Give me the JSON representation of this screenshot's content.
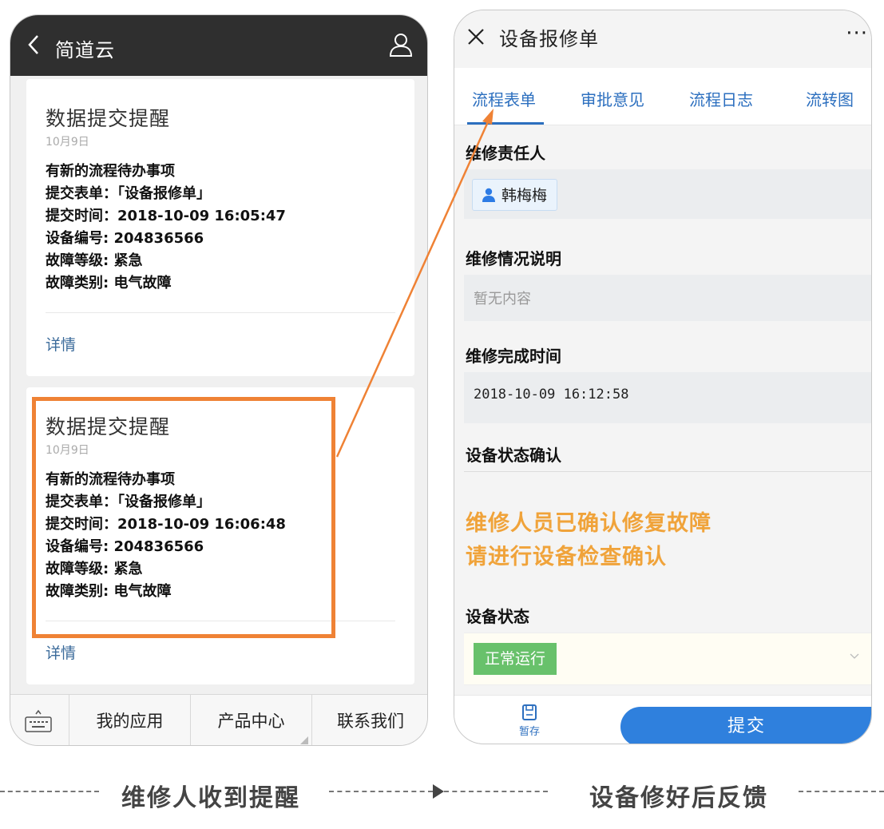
{
  "left_phone": {
    "header": {
      "title": "简道云"
    },
    "cards": [
      {
        "title": "数据提交提醒",
        "date": "10月9日",
        "lines": [
          "有新的流程待办事项",
          "提交表单：「设备报修单」",
          "提交时间：2018-10-09 16:05:47",
          "设备编号: 204836566",
          "故障等级: 紧急",
          "故障类别: 电气故障"
        ],
        "link": "详情"
      },
      {
        "title": "数据提交提醒",
        "date": "10月9日",
        "lines": [
          "有新的流程待办事项",
          "提交表单：「设备报修单」",
          "提交时间：2018-10-09 16:06:48",
          "设备编号: 204836566",
          "故障等级: 紧急",
          "故障类别: 电气故障"
        ],
        "link": "详情"
      }
    ],
    "footer_menu": [
      "我的应用",
      "产品中心",
      "联系我们"
    ]
  },
  "right_phone": {
    "header": {
      "title": "设备报修单",
      "more": "···"
    },
    "tabs": [
      "流程表单",
      "审批意见",
      "流程日志",
      "流转图"
    ],
    "fields": {
      "responsible_label": "维修责任人",
      "responsible_value": "韩梅梅",
      "description_label": "维修情况说明",
      "description_placeholder": "暂无内容",
      "finish_time_label": "维修完成时间",
      "finish_time_value": "2018-10-09  16:12:58",
      "confirm_label": "设备状态确认",
      "notice_line1": "维修人员已确认修复故障",
      "notice_line2": "请进行设备检查确认",
      "status_label": "设备状态",
      "status_value": "正常运行"
    },
    "footer": {
      "save_label": "暂存",
      "submit_label": "提交"
    }
  },
  "caption": {
    "left_text": "维修人收到提醒",
    "right_text": "设备修好后反馈"
  },
  "colors": {
    "highlight": "#ef8235",
    "accent_blue": "#2c6fbf",
    "notice_orange": "#f0a33a",
    "status_green": "#68c16b"
  }
}
